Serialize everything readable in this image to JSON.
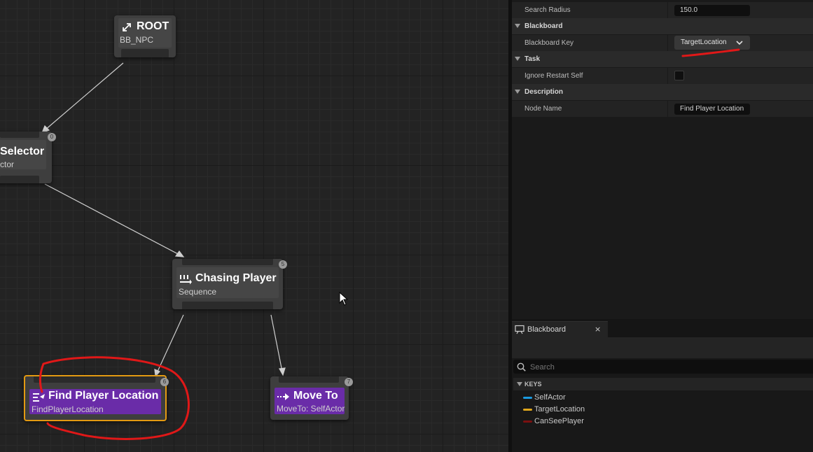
{
  "graph": {
    "nodes": {
      "root": {
        "title": "ROOT",
        "subtitle": "BB_NPC"
      },
      "selector": {
        "title": "Selector",
        "subtitle": "ctor",
        "badge": "0"
      },
      "chasing": {
        "title": "Chasing Player",
        "subtitle": "Sequence",
        "badge": "5"
      },
      "find": {
        "title": "Find Player Location",
        "subtitle": "FindPlayerLocation",
        "badge": "6"
      },
      "moveto": {
        "title": "Move To",
        "subtitle": "MoveTo: SelfActor",
        "badge": "7"
      }
    }
  },
  "details": {
    "search_radius": {
      "label": "Search Radius",
      "value": "150.0"
    },
    "blackboard_category": "Blackboard",
    "blackboard_key": {
      "label": "Blackboard Key",
      "value": "TargetLocation"
    },
    "task_category": "Task",
    "ignore_restart_self": {
      "label": "Ignore Restart Self",
      "checked": false
    },
    "description_category": "Description",
    "node_name": {
      "label": "Node Name",
      "value": "Find Player Location"
    }
  },
  "blackboard_panel": {
    "tab_label": "Blackboard",
    "close_label": "×",
    "search_placeholder": "Search",
    "keys_header": "KEYS",
    "keys": [
      {
        "name": "SelfActor",
        "color": "#1a9be0"
      },
      {
        "name": "TargetLocation",
        "color": "#e0a81c"
      },
      {
        "name": "CanSeePlayer",
        "color": "#7a1010"
      }
    ]
  },
  "colors": {
    "task_node": "#6a2ca8",
    "selected_outline": "#e39a12",
    "annotation": "#e01818"
  }
}
